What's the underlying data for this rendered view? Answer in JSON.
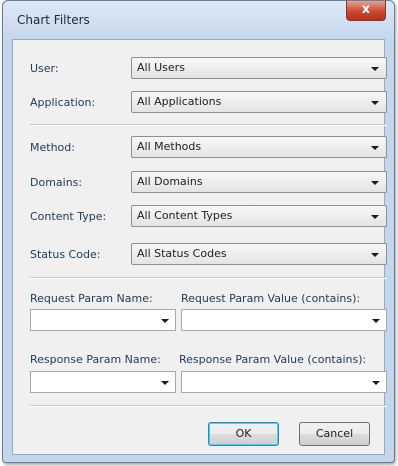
{
  "window": {
    "title": "Chart Filters",
    "close_glyph": "x"
  },
  "filters": {
    "user": {
      "label": "User:",
      "value": "All Users"
    },
    "application": {
      "label": "Application:",
      "value": "All Applications"
    },
    "method": {
      "label": "Method:",
      "value": "All Methods"
    },
    "domains": {
      "label": "Domains:",
      "value": "All Domains"
    },
    "content_type": {
      "label": "Content Type:",
      "value": "All Content Types"
    },
    "status_code": {
      "label": "Status Code:",
      "value": "All Status Codes"
    }
  },
  "params": {
    "request_name": {
      "label": "Request Param Name:",
      "value": ""
    },
    "request_value": {
      "label": "Request Param Value (contains):",
      "value": ""
    },
    "response_name": {
      "label": "Response Param Name:",
      "value": ""
    },
    "response_value": {
      "label": "Response Param Value (contains):",
      "value": ""
    }
  },
  "buttons": {
    "ok": "OK",
    "cancel": "Cancel"
  },
  "colors": {
    "close_button": "#c9492e",
    "label_text": "#1e395b",
    "window_frame": "#c4d6ec"
  }
}
